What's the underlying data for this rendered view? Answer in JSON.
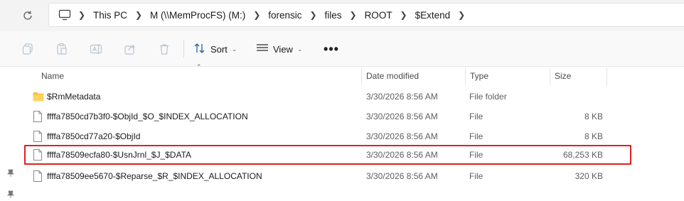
{
  "address_bar": {
    "refresh_icon": "refresh-icon",
    "computer_icon": "computer-icon",
    "breadcrumbs": [
      "This PC",
      "M (\\\\MemProcFS) (M:)",
      "forensic",
      "files",
      "ROOT",
      "$Extend"
    ]
  },
  "toolbar": {
    "icons": [
      "copy-icon",
      "paste-icon",
      "rename-icon",
      "share-icon",
      "delete-icon"
    ],
    "sort_label": "Sort",
    "view_label": "View",
    "more_label": "•••"
  },
  "columns": {
    "name": "Name",
    "date": "Date modified",
    "type": "Type",
    "size": "Size"
  },
  "rows": [
    {
      "name": "$RmMetadata",
      "date": "3/30/2026 8:56 AM",
      "type": "File folder",
      "size": "",
      "icon": "folder-icon"
    },
    {
      "name": "ffffa7850cd7b3f0-$ObjId_$O_$INDEX_ALLOCATION",
      "date": "3/30/2026 8:56 AM",
      "type": "File",
      "size": "8 KB",
      "icon": "file-icon"
    },
    {
      "name": "ffffa7850cd77a20-$ObjId",
      "date": "3/30/2026 8:56 AM",
      "type": "File",
      "size": "8 KB",
      "icon": "file-icon"
    },
    {
      "name": "ffffa78509ecfa80-$UsnJrnl_$J_$DATA",
      "date": "3/30/2026 8:56 AM",
      "type": "File",
      "size": "68,253 KB",
      "icon": "file-icon"
    },
    {
      "name": "ffffa78509ee5670-$Reparse_$R_$INDEX_ALLOCATION",
      "date": "3/30/2026 8:56 AM",
      "type": "File",
      "size": "320 KB",
      "icon": "file-icon"
    }
  ],
  "highlight_color": "#e02020",
  "folder_color": "#f5c040"
}
